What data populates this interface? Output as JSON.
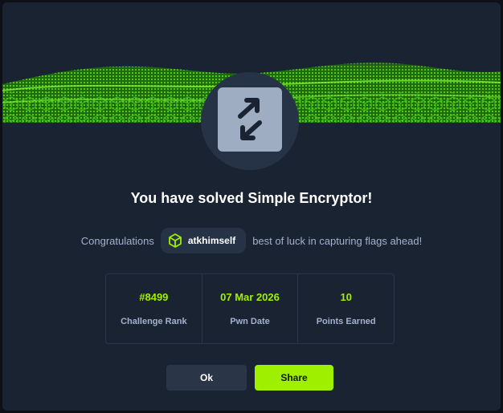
{
  "modal": {
    "title": "You have solved Simple Encryptor!",
    "congrats_prefix": "Congratulations",
    "username": "atkhimself",
    "congrats_suffix": "best of luck in capturing flags ahead!",
    "badge_icon": "swap-arrows-icon",
    "user_icon": "hexagon-box-icon"
  },
  "stats": [
    {
      "value": "#8499",
      "label": "Challenge Rank"
    },
    {
      "value": "07 Mar 2026",
      "label": "Pwn Date"
    },
    {
      "value": "10",
      "label": "Points Earned"
    }
  ],
  "buttons": {
    "ok_label": "Ok",
    "share_label": "Share"
  },
  "colors": {
    "background": "#1a2332",
    "accent": "#9fef00",
    "muted_text": "#a4b1cd",
    "chip_background": "#263347"
  }
}
